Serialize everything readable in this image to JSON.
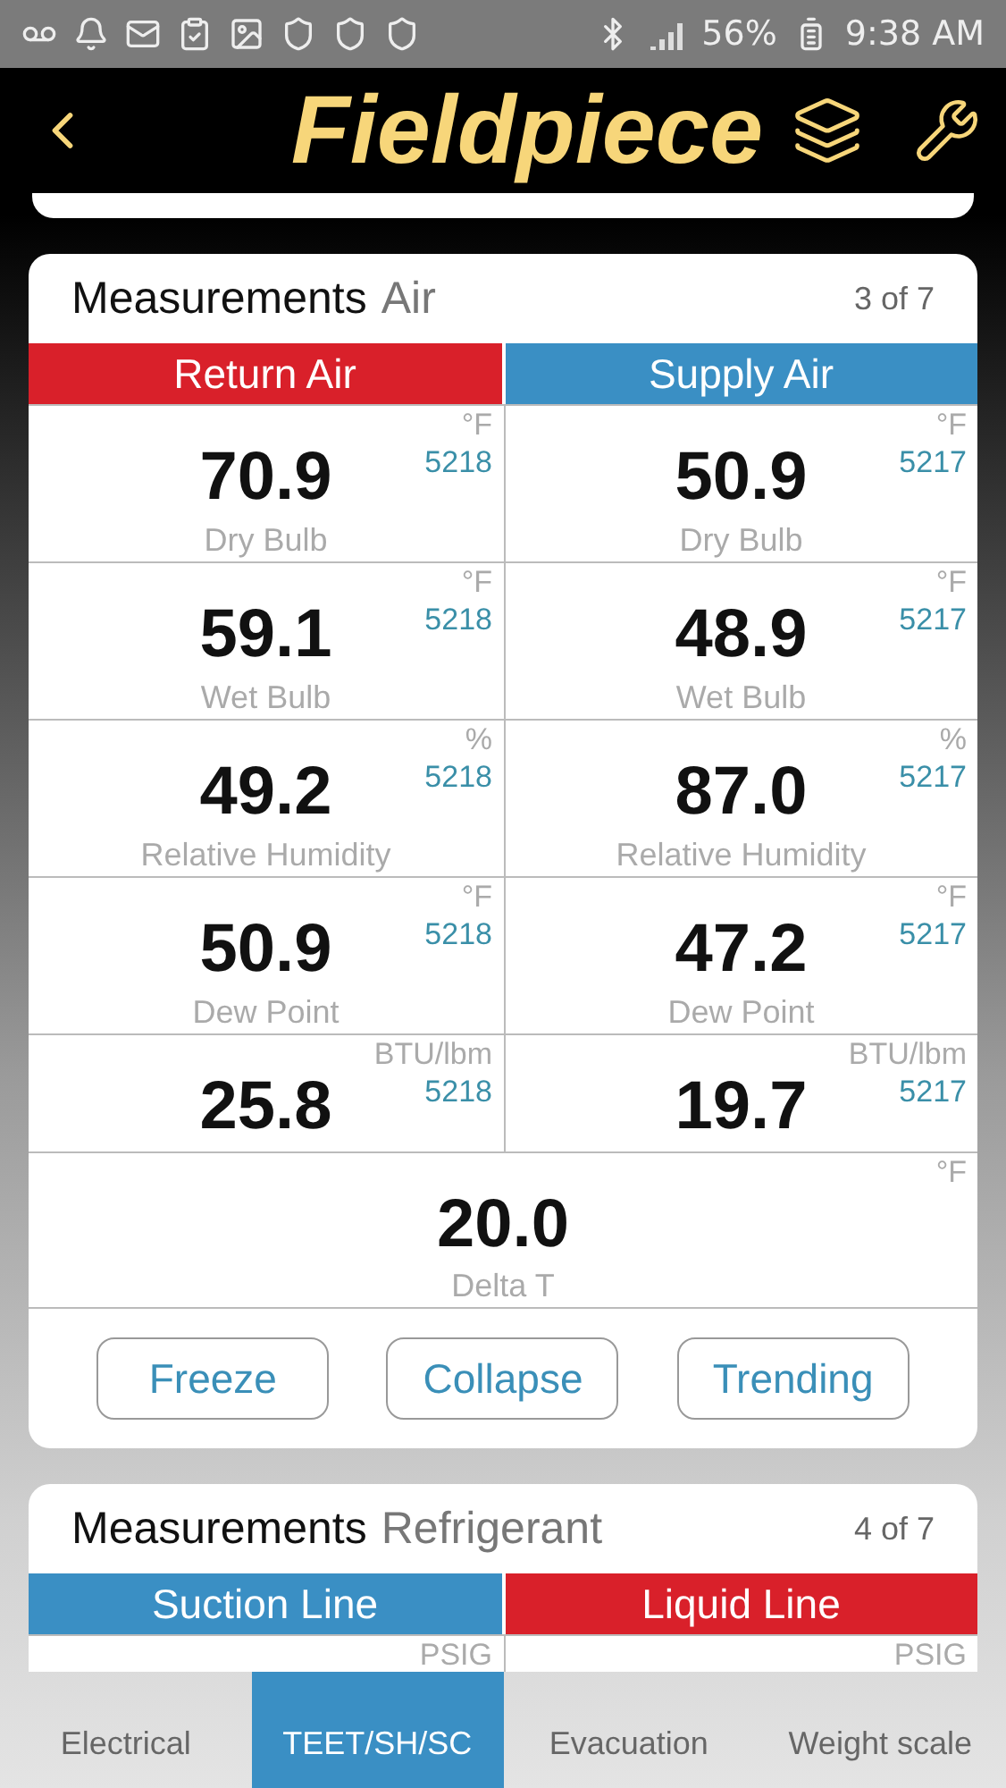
{
  "status_bar": {
    "battery": "56%",
    "time": "9:38 AM"
  },
  "header": {
    "logo": "Fieldpiece"
  },
  "cards": [
    {
      "title": "Measurements",
      "subtitle": "Air",
      "page": "3 of 7",
      "columns": [
        {
          "label": "Return Air",
          "color": "#d9202a"
        },
        {
          "label": "Supply Air",
          "color": "#3a8fc4"
        }
      ],
      "rows": [
        {
          "kind": "pair",
          "cells": [
            {
              "value": "70.9",
              "unit": "°F",
              "device": "5218",
              "label": "Dry Bulb"
            },
            {
              "value": "50.9",
              "unit": "°F",
              "device": "5217",
              "label": "Dry Bulb"
            }
          ]
        },
        {
          "kind": "pair",
          "cells": [
            {
              "value": "59.1",
              "unit": "°F",
              "device": "5218",
              "label": "Wet Bulb"
            },
            {
              "value": "48.9",
              "unit": "°F",
              "device": "5217",
              "label": "Wet Bulb"
            }
          ]
        },
        {
          "kind": "pair",
          "cells": [
            {
              "value": "49.2",
              "unit": "%",
              "device": "5218",
              "label": "Relative Humidity"
            },
            {
              "value": "87.0",
              "unit": "%",
              "device": "5217",
              "label": "Relative Humidity"
            }
          ]
        },
        {
          "kind": "pair",
          "cells": [
            {
              "value": "50.9",
              "unit": "°F",
              "device": "5218",
              "label": "Dew Point"
            },
            {
              "value": "47.2",
              "unit": "°F",
              "device": "5217",
              "label": "Dew Point"
            }
          ]
        },
        {
          "kind": "pair",
          "cells": [
            {
              "value": "25.8",
              "unit": "BTU/lbm",
              "device": "5218"
            },
            {
              "value": "19.7",
              "unit": "BTU/lbm",
              "device": "5217"
            }
          ]
        },
        {
          "kind": "single",
          "cells": [
            {
              "value": "20.0",
              "unit": "°F",
              "label": "Delta T"
            }
          ]
        }
      ],
      "buttons": [
        "Freeze",
        "Collapse",
        "Trending"
      ]
    },
    {
      "title": "Measurements",
      "subtitle": "Refrigerant",
      "page": "4 of 7",
      "columns": [
        {
          "label": "Suction Line",
          "color": "#3a8fc4"
        },
        {
          "label": "Liquid Line",
          "color": "#d9202a"
        }
      ],
      "rows": [
        {
          "kind": "cut",
          "cells": [
            {
              "unit": "PSIG"
            },
            {
              "unit": "PSIG"
            }
          ]
        }
      ]
    }
  ],
  "tabs": [
    {
      "label": "Electrical",
      "selected": false
    },
    {
      "label": "TEET/SH/SC",
      "selected": true
    },
    {
      "label": "Evacuation",
      "selected": false
    },
    {
      "label": "Weight scale",
      "selected": false
    }
  ]
}
